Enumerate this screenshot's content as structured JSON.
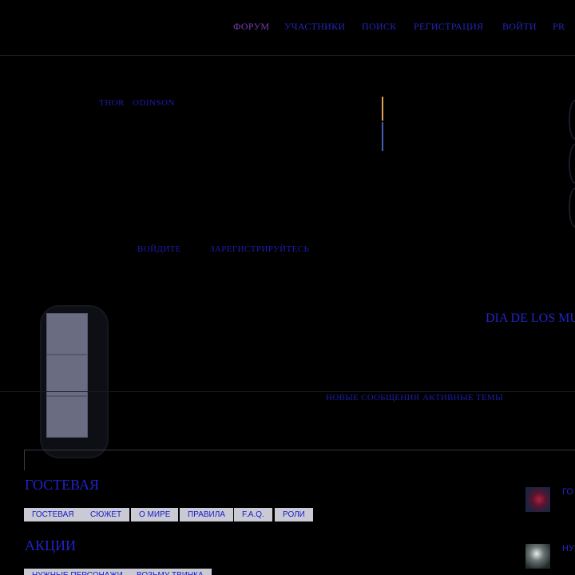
{
  "nav": {
    "items": [
      {
        "label": "ФОРУМ"
      },
      {
        "label": "УЧАСТНИКИ"
      },
      {
        "label": "ПОИСК"
      },
      {
        "label": "РЕГИСТРАЦИЯ"
      },
      {
        "label": "ВОЙТИ"
      },
      {
        "label": "PR"
      }
    ]
  },
  "header": {
    "first_name": "THOR",
    "last_name": "ODINSON",
    "login_link": "ВОЙДИТЕ",
    "register_link": "ЗАРЕГИСТРИРУЙТЕСЬ",
    "hero_title": "DIA DE LOS MU"
  },
  "subnav": {
    "new_posts": "НОВЫЕ СООБЩЕНИЯ",
    "active_topics": "АКТИВНЫЕ ТЕМЫ"
  },
  "sections": [
    {
      "title": "ГОСТЕВАЯ",
      "tags": [
        "ГОСТЕВАЯ",
        "СЮЖЕТ",
        "О МИРЕ",
        "ПРАВИЛА",
        "F.A.Q.",
        "РОЛИ"
      ]
    },
    {
      "title": "АКЦИИ",
      "tags": [
        "НУЖНЫЕ ПЕРСОНАЖИ",
        "ВОЗЬМУ ТВИНКА"
      ]
    }
  ],
  "sidebar_links": [
    "ГО",
    "НУ"
  ],
  "colors": {
    "background": "#000000",
    "link": "#2424b8",
    "active_nav": "#7b3cb0",
    "accent_orange": "#e0a060",
    "accent_blue": "#4a5cb0",
    "tag_bg": "#c9cad4"
  }
}
